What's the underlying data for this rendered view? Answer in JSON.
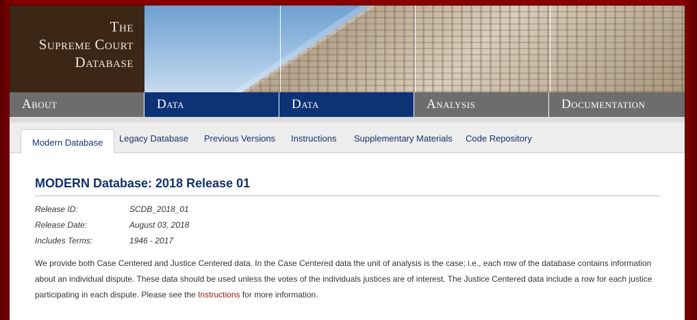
{
  "logo": {
    "line1": "The",
    "line2": "Supreme Court",
    "line3": "Database"
  },
  "main_nav": [
    "About",
    "Data",
    "Data",
    "Analysis",
    "Documentation"
  ],
  "sub_tabs": [
    "Modern Database",
    "Legacy Database",
    "Previous Versions",
    "Instructions",
    "Supplementary Materials",
    "Code Repository"
  ],
  "page": {
    "title": "MODERN Database: 2018 Release 01",
    "meta": [
      {
        "key": "Release ID:",
        "value": "SCDB_2018_01"
      },
      {
        "key": "Release Date:",
        "value": "August 03, 2018"
      },
      {
        "key": "Includes Terms:",
        "value": "1946 - 2017"
      }
    ],
    "desc_before": "We provide both Case Centered and Justice Centered data. In the Case Centered data the unit of analysis is the case; i.e., each row of the database contains information about an individual dispute. These data should be used unless the votes of the individuals justices are of interest. The Justice Centered data include a row for each justice participating in each dispute. Please see the ",
    "desc_link": "Instructions",
    "desc_after": " for more information."
  },
  "colors": {
    "nav_blue": "#0d3276",
    "nav_gray": "#6d6d6d",
    "logo_bg": "#3c2616",
    "frame_red": "#8a0000",
    "link_red": "#9b1212"
  }
}
